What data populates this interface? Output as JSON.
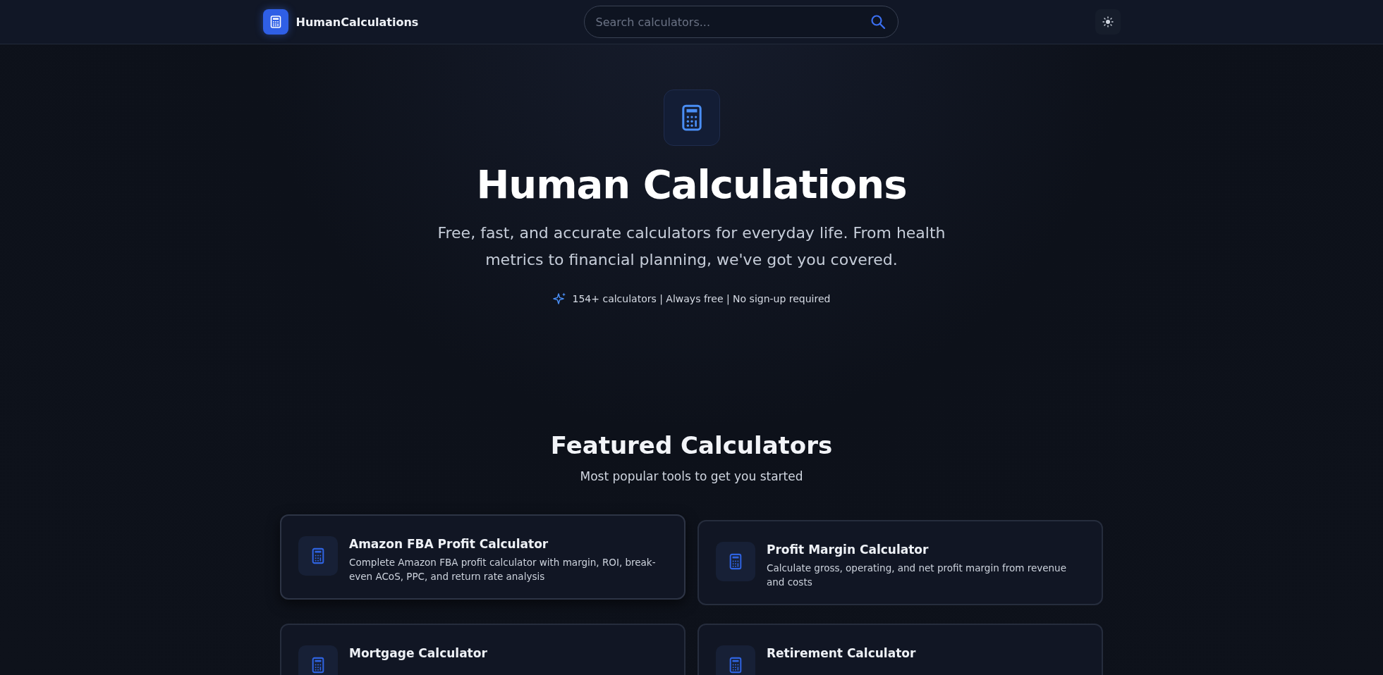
{
  "header": {
    "brand": "HumanCalculations",
    "search": {
      "placeholder": "Search calculators..."
    }
  },
  "hero": {
    "title": "Human Calculations",
    "subtitle": "Free, fast, and accurate calculators for everyday life. From health metrics to financial planning, we've got you covered.",
    "tagline": "154+ calculators | Always free | No sign-up required"
  },
  "featured": {
    "title": "Featured Calculators",
    "subtitle": "Most popular tools to get you started",
    "cards": [
      {
        "title": "Amazon FBA Profit Calculator",
        "description": "Complete Amazon FBA profit calculator with margin, ROI, break-even ACoS, PPC, and return rate analysis",
        "hovered": true
      },
      {
        "title": "Profit Margin Calculator",
        "description": "Calculate gross, operating, and net profit margin from revenue and costs",
        "hovered": false
      },
      {
        "title": "Mortgage Calculator",
        "hovered": false
      },
      {
        "title": "Retirement Calculator",
        "hovered": false
      }
    ]
  }
}
